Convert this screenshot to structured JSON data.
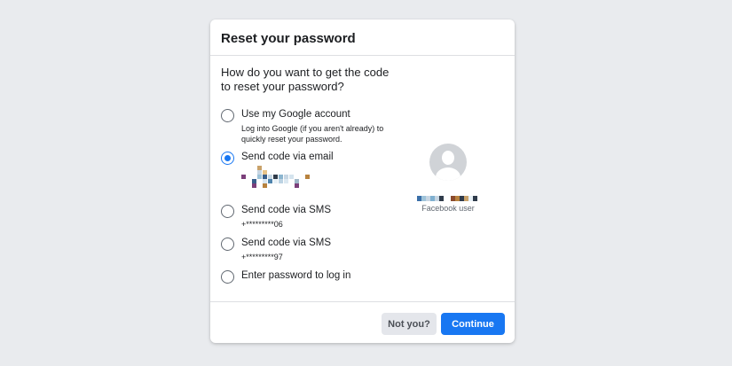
{
  "dialog": {
    "title": "Reset your password",
    "question": "How do you want to get the code to reset your password?"
  },
  "options": [
    {
      "label": "Use my Google account",
      "sub": "Log into Google (if you aren't already) to quickly reset your password.",
      "selected": false
    },
    {
      "label": "Send code via email",
      "sub": "",
      "selected": true
    },
    {
      "label": "Send code via SMS",
      "sub": "+*********06",
      "selected": false
    },
    {
      "label": "Send code via SMS",
      "sub": "+*********97",
      "selected": false
    },
    {
      "label": "Enter password to log in",
      "sub": "",
      "selected": false
    }
  ],
  "profile": {
    "label": "Facebook user",
    "avatar_icon": "default-user-avatar-icon"
  },
  "footer": {
    "not_you_label": "Not you?",
    "continue_label": "Continue"
  },
  "colors": {
    "accent": "#1877f2",
    "background": "#e9ebee",
    "secondary_button": "#e4e6eb"
  }
}
